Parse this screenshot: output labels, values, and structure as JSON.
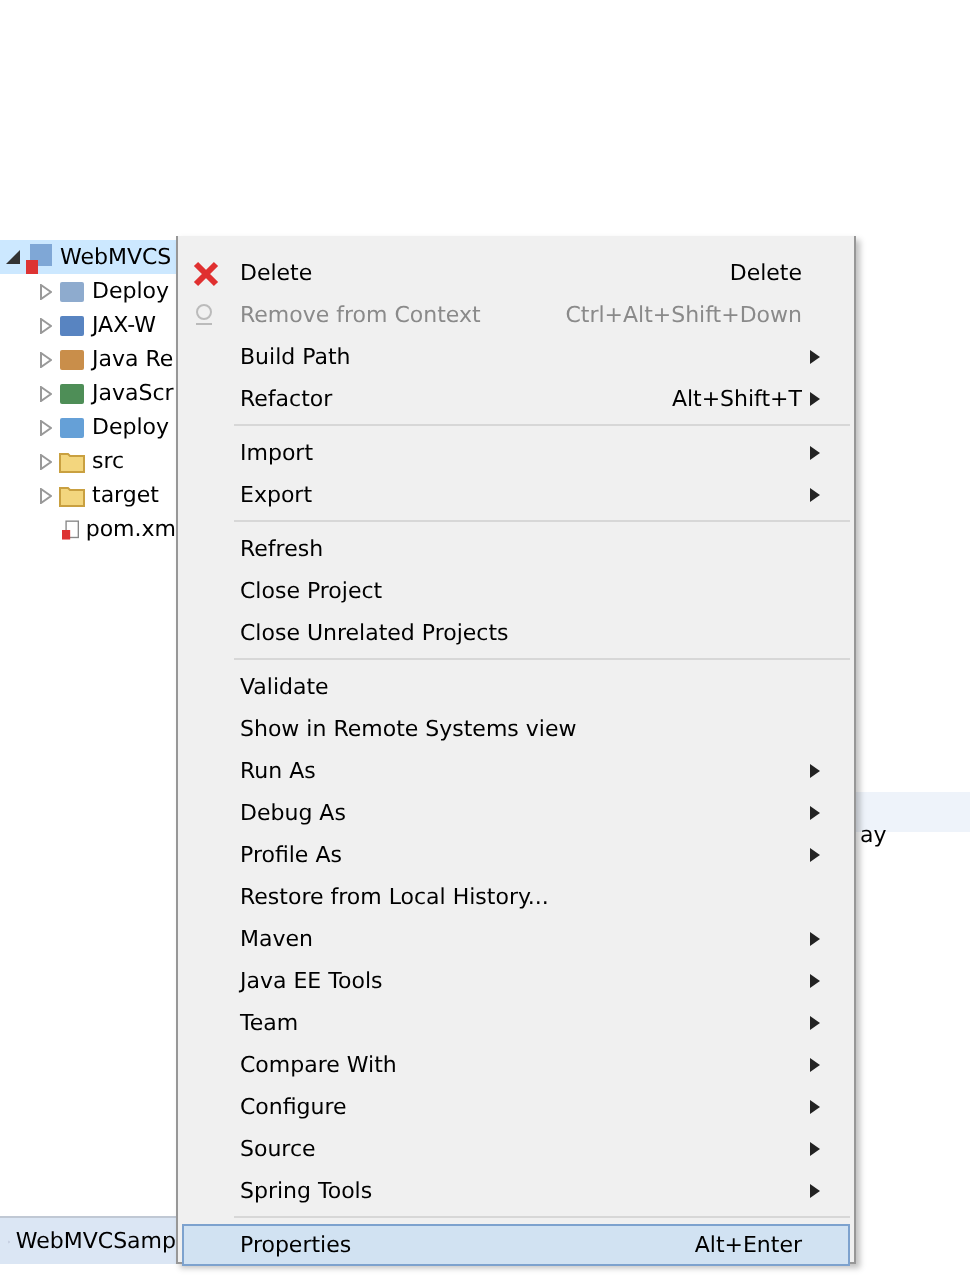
{
  "project_tree": {
    "root": {
      "label": "WebMVCS",
      "expanded": true,
      "selected": true,
      "children": [
        {
          "label": "Deploy",
          "expanded": false
        },
        {
          "label": "JAX-W",
          "expanded": false
        },
        {
          "label": "Java Re",
          "expanded": false
        },
        {
          "label": "JavaScr",
          "expanded": false
        },
        {
          "label": "Deploy",
          "expanded": false
        },
        {
          "label": "src",
          "expanded": false
        },
        {
          "label": "target",
          "expanded": false
        },
        {
          "label": "pom.xm"
        }
      ]
    }
  },
  "context_menu": [
    {
      "kind": "item",
      "label": "Delete",
      "shortcut": "Delete",
      "submenu": false,
      "disabled": false,
      "selected": false
    },
    {
      "kind": "item",
      "label": "Remove from Context",
      "shortcut": "Ctrl+Alt+Shift+Down",
      "submenu": false,
      "disabled": true,
      "selected": false
    },
    {
      "kind": "item",
      "label": "Build Path",
      "submenu": true,
      "disabled": false,
      "selected": false
    },
    {
      "kind": "item",
      "label": "Refactor",
      "shortcut": "Alt+Shift+T",
      "submenu": true,
      "disabled": false,
      "selected": false
    },
    {
      "kind": "separator"
    },
    {
      "kind": "item",
      "label": "Import",
      "submenu": true,
      "disabled": false,
      "selected": false
    },
    {
      "kind": "item",
      "label": "Export",
      "submenu": true,
      "disabled": false,
      "selected": false
    },
    {
      "kind": "separator"
    },
    {
      "kind": "item",
      "label": "Refresh",
      "submenu": false,
      "disabled": false,
      "selected": false
    },
    {
      "kind": "item",
      "label": "Close Project",
      "submenu": false,
      "disabled": false,
      "selected": false
    },
    {
      "kind": "item",
      "label": "Close Unrelated Projects",
      "submenu": false,
      "disabled": false,
      "selected": false
    },
    {
      "kind": "separator"
    },
    {
      "kind": "item",
      "label": "Validate",
      "submenu": false,
      "disabled": false,
      "selected": false
    },
    {
      "kind": "item",
      "label": "Show in Remote Systems view",
      "submenu": false,
      "disabled": false,
      "selected": false
    },
    {
      "kind": "item",
      "label": "Run As",
      "submenu": true,
      "disabled": false,
      "selected": false
    },
    {
      "kind": "item",
      "label": "Debug As",
      "submenu": true,
      "disabled": false,
      "selected": false
    },
    {
      "kind": "item",
      "label": "Profile As",
      "submenu": true,
      "disabled": false,
      "selected": false
    },
    {
      "kind": "item",
      "label": "Restore from Local History...",
      "submenu": false,
      "disabled": false,
      "selected": false
    },
    {
      "kind": "item",
      "label": "Maven",
      "submenu": true,
      "disabled": false,
      "selected": false
    },
    {
      "kind": "item",
      "label": "Java EE Tools",
      "submenu": true,
      "disabled": false,
      "selected": false
    },
    {
      "kind": "item",
      "label": "Team",
      "submenu": true,
      "disabled": false,
      "selected": false
    },
    {
      "kind": "item",
      "label": "Compare With",
      "submenu": true,
      "disabled": false,
      "selected": false
    },
    {
      "kind": "item",
      "label": "Configure",
      "submenu": true,
      "disabled": false,
      "selected": false
    },
    {
      "kind": "item",
      "label": "Source",
      "submenu": true,
      "disabled": false,
      "selected": false
    },
    {
      "kind": "item",
      "label": "Spring Tools",
      "submenu": true,
      "disabled": false,
      "selected": false
    },
    {
      "kind": "separator"
    },
    {
      "kind": "item",
      "label": "Properties",
      "shortcut": "Alt+Enter",
      "submenu": false,
      "disabled": false,
      "selected": true
    }
  ],
  "background_panel": {
    "text": "ay"
  },
  "bottom_tab": {
    "label": "WebMVCSamp"
  }
}
